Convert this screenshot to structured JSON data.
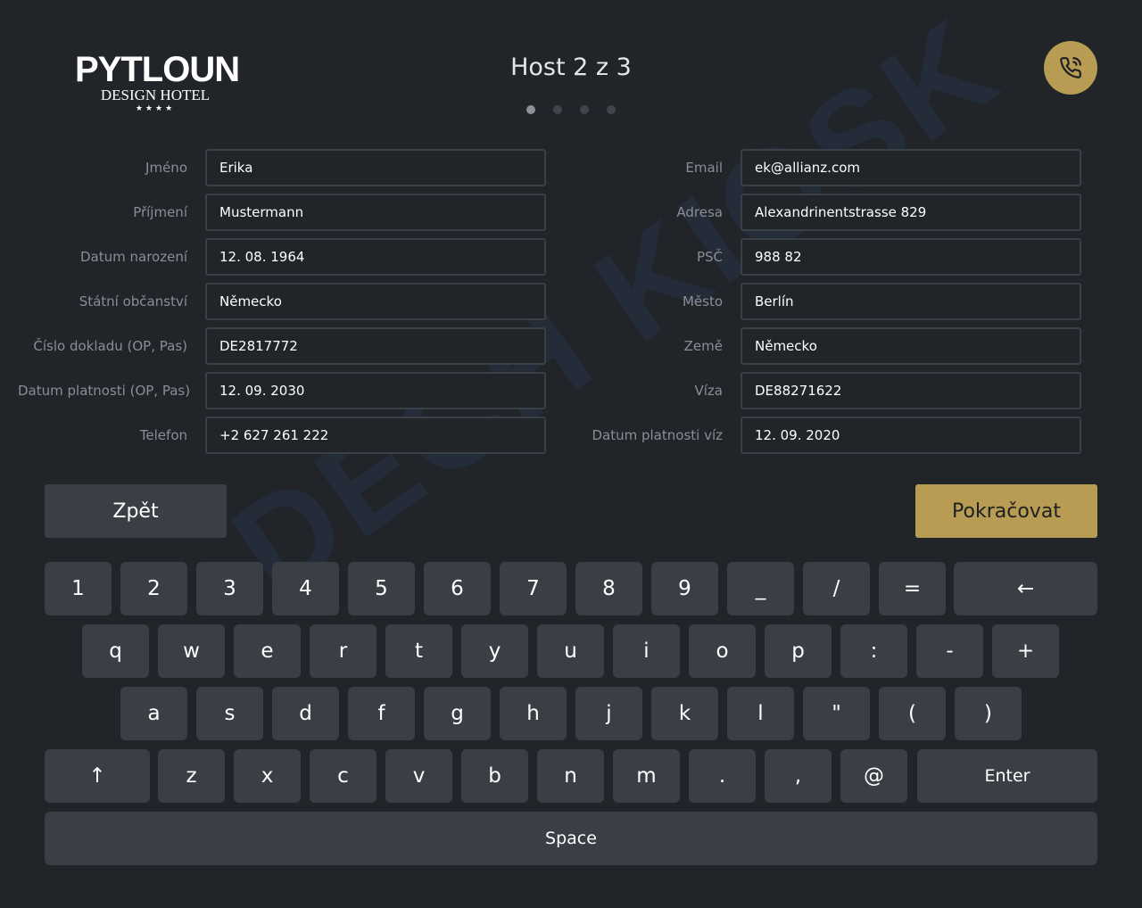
{
  "header": {
    "logo_name": "PYTLOUN",
    "logo_sub": "DESIGN HOTEL",
    "logo_stars": "★★★★",
    "title": "Host 2 z 3",
    "pager": {
      "total": 4,
      "active": 1
    },
    "call_icon": "phone-icon"
  },
  "watermark": "DECH KIOSK",
  "form": {
    "left": [
      {
        "label": "Jméno",
        "value": "Erika"
      },
      {
        "label": "Příjmení",
        "value": "Mustermann"
      },
      {
        "label": "Datum narození",
        "value": "12. 08. 1964"
      },
      {
        "label": "Státní občanství",
        "value": "Německo"
      },
      {
        "label": "Číslo dokladu (OP, Pas)",
        "value": "DE2817772"
      },
      {
        "label": "Datum platnosti (OP, Pas)",
        "value": "12. 09. 2030"
      },
      {
        "label": "Telefon",
        "value": "+2 627 261 222"
      }
    ],
    "right": [
      {
        "label": "Email",
        "value": "ek@allianz.com"
      },
      {
        "label": "Adresa",
        "value": "Alexandrinentstrasse 829"
      },
      {
        "label": "PSČ",
        "value": "988 82"
      },
      {
        "label": "Město",
        "value": "Berlín"
      },
      {
        "label": "Země",
        "value": "Německo"
      },
      {
        "label": "Víza",
        "value": "DE88271622"
      },
      {
        "label": "Datum platnosti víz",
        "value": "12. 09. 2020"
      }
    ]
  },
  "nav": {
    "back_label": "Zpět",
    "continue_label": "Pokračovat"
  },
  "keyboard": {
    "rows": [
      [
        "1",
        "2",
        "3",
        "4",
        "5",
        "6",
        "7",
        "8",
        "9",
        "_",
        "/",
        "=",
        "←"
      ],
      [
        "q",
        "w",
        "e",
        "r",
        "t",
        "y",
        "u",
        "i",
        "o",
        "p",
        ":",
        "-",
        "+"
      ],
      [
        "a",
        "s",
        "d",
        "f",
        "g",
        "h",
        "j",
        "k",
        "l",
        "\"",
        "(",
        ")"
      ],
      [
        "↑",
        "z",
        "x",
        "c",
        "v",
        "b",
        "n",
        "m",
        ".",
        ",",
        "@",
        "Enter"
      ],
      [
        "Space"
      ]
    ]
  },
  "colors": {
    "background": "#212429",
    "key": "#3a3e45",
    "accent": "#b89c54",
    "input_border": "#3b3f46",
    "label": "#8a8e95"
  }
}
